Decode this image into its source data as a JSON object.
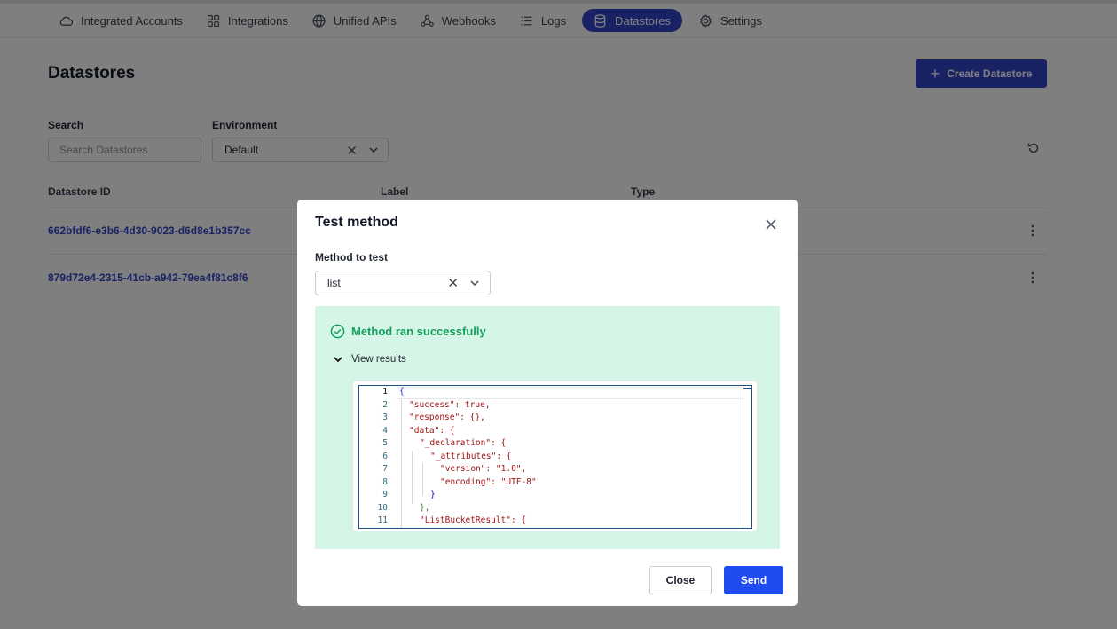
{
  "nav": {
    "items": [
      {
        "label": "Integrated Accounts",
        "icon": "cloud-icon"
      },
      {
        "label": "Integrations",
        "icon": "grid-icon"
      },
      {
        "label": "Unified APIs",
        "icon": "globe-icon"
      },
      {
        "label": "Webhooks",
        "icon": "webhook-icon"
      },
      {
        "label": "Logs",
        "icon": "list-icon"
      },
      {
        "label": "Datastores",
        "icon": "database-icon",
        "active": true
      },
      {
        "label": "Settings",
        "icon": "gear-icon"
      }
    ]
  },
  "page": {
    "title": "Datastores",
    "create_button": "Create Datastore"
  },
  "filters": {
    "search_label": "Search",
    "search_placeholder": "Search Datastores",
    "environment_label": "Environment",
    "environment_value": "Default"
  },
  "table": {
    "columns": [
      "Datastore ID",
      "Label",
      "Type"
    ],
    "rows": [
      {
        "id": "662bfdf6-e3b6-4d30-9023-d6d8e1b357cc"
      },
      {
        "id": "879d72e4-2315-41cb-a942-79ea4f81c8f6"
      }
    ]
  },
  "modal": {
    "title": "Test method",
    "method_label": "Method to test",
    "method_value": "list",
    "success_text": "Method ran successfully",
    "view_results_label": "View results",
    "close_button": "Close",
    "send_button": "Send",
    "code_lines": [
      "{",
      "\"success\": true,",
      "\"response\": {},",
      "\"data\": {",
      "\"_declaration\": {",
      "\"_attributes\": {",
      "\"version\": \"1.0\",",
      "\"encoding\": \"UTF-8\"",
      "}",
      "},",
      "\"ListBucketResult\": {"
    ],
    "line_numbers": [
      "1",
      "2",
      "3",
      "4",
      "5",
      "6",
      "7",
      "8",
      "9",
      "10",
      "11"
    ]
  },
  "colors": {
    "accent": "#3245c8",
    "send": "#1f4cf0",
    "success_bg": "#d5f6e7",
    "success_text": "#13a05d"
  }
}
